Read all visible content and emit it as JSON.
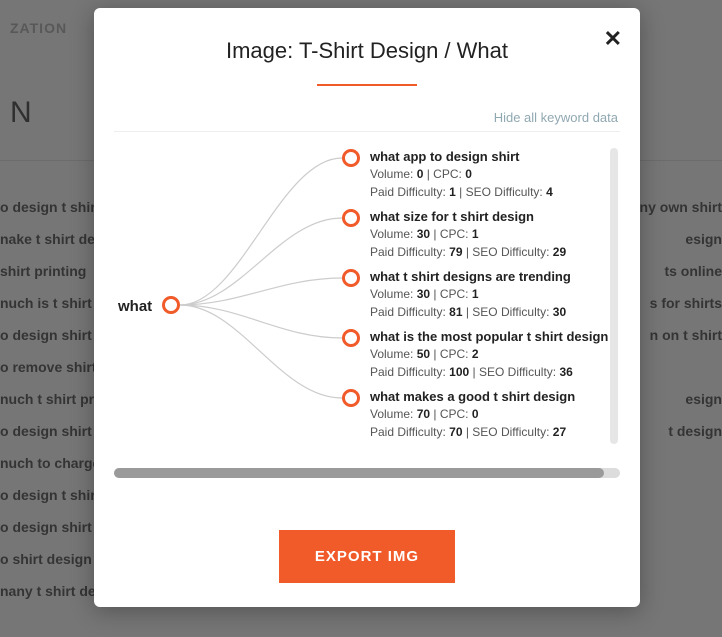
{
  "bg": {
    "nav": "ZATION",
    "title_fragment": "N",
    "rows": [
      {
        "left": "o design t shirt",
        "right": "ny own shirt"
      },
      {
        "left": "nake t shirt desi",
        "right": "esign"
      },
      {
        "left": "shirt printing",
        "right": "ts online"
      },
      {
        "left": "nuch is t shirt pr",
        "right": "s for shirts"
      },
      {
        "left": "o design shirt lc",
        "right": "n on t shirt"
      },
      {
        "left": "o remove shirt c",
        "right": ""
      },
      {
        "left": "nuch t shirt prin",
        "right": "esign"
      },
      {
        "left": "o design shirt o",
        "right": "t design"
      },
      {
        "left": "nuch to charge",
        "right": ""
      },
      {
        "left": "o design t shirts",
        "right": ""
      },
      {
        "left": "o design shirt in",
        "right": ""
      },
      {
        "left": "o shirt design",
        "right": ""
      },
      {
        "left": "nany t shirt desi",
        "right": ""
      }
    ]
  },
  "modal": {
    "title": "Image: T-Shirt Design / What",
    "hide_link": "Hide all keyword data",
    "root_label": "what",
    "export_label": "EXPORT IMG",
    "children": [
      {
        "title": "what app to design shirt",
        "volume": "0",
        "cpc": "0",
        "pd": "1",
        "sd": "4"
      },
      {
        "title": "what size for t shirt design",
        "volume": "30",
        "cpc": "1",
        "pd": "79",
        "sd": "29"
      },
      {
        "title": "what t shirt designs are trending",
        "volume": "30",
        "cpc": "1",
        "pd": "81",
        "sd": "30"
      },
      {
        "title": "what is the most popular t shirt design",
        "volume": "50",
        "cpc": "2",
        "pd": "100",
        "sd": "36"
      },
      {
        "title": "what makes a good t shirt design",
        "volume": "70",
        "cpc": "0",
        "pd": "70",
        "sd": "27"
      }
    ],
    "labels": {
      "volume": "Volume:",
      "cpc": "CPC:",
      "pd": "Paid Difficulty:",
      "sd": "SEO Difficulty:"
    }
  }
}
